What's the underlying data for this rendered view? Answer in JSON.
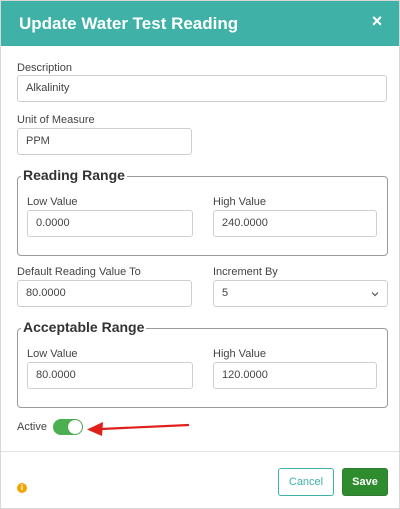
{
  "dialog": {
    "title": "Update Water Test Reading",
    "close_symbol": "×"
  },
  "description": {
    "label": "Description",
    "value": "Alkalinity"
  },
  "unit": {
    "label": "Unit of Measure",
    "value": "PPM"
  },
  "reading_range": {
    "legend": "Reading Range",
    "low": {
      "label": "Low Value",
      "value": "0.0000"
    },
    "high": {
      "label": "High Value",
      "value": "240.0000"
    }
  },
  "default_reading": {
    "label": "Default Reading Value To",
    "value": "80.0000"
  },
  "increment": {
    "label": "Increment By",
    "value": "5"
  },
  "acceptable_range": {
    "legend": "Acceptable Range",
    "low": {
      "label": "Low Value",
      "value": "80.0000"
    },
    "high": {
      "label": "High Value",
      "value": "120.0000"
    }
  },
  "active": {
    "label": "Active",
    "on": true
  },
  "footer": {
    "info_symbol": "i",
    "cancel_label": "Cancel",
    "save_label": "Save"
  },
  "colors": {
    "header": "#3fb1a6",
    "toggle_on": "#4caf50",
    "save": "#2e8b2e",
    "annotation_arrow": "#e0201b"
  }
}
